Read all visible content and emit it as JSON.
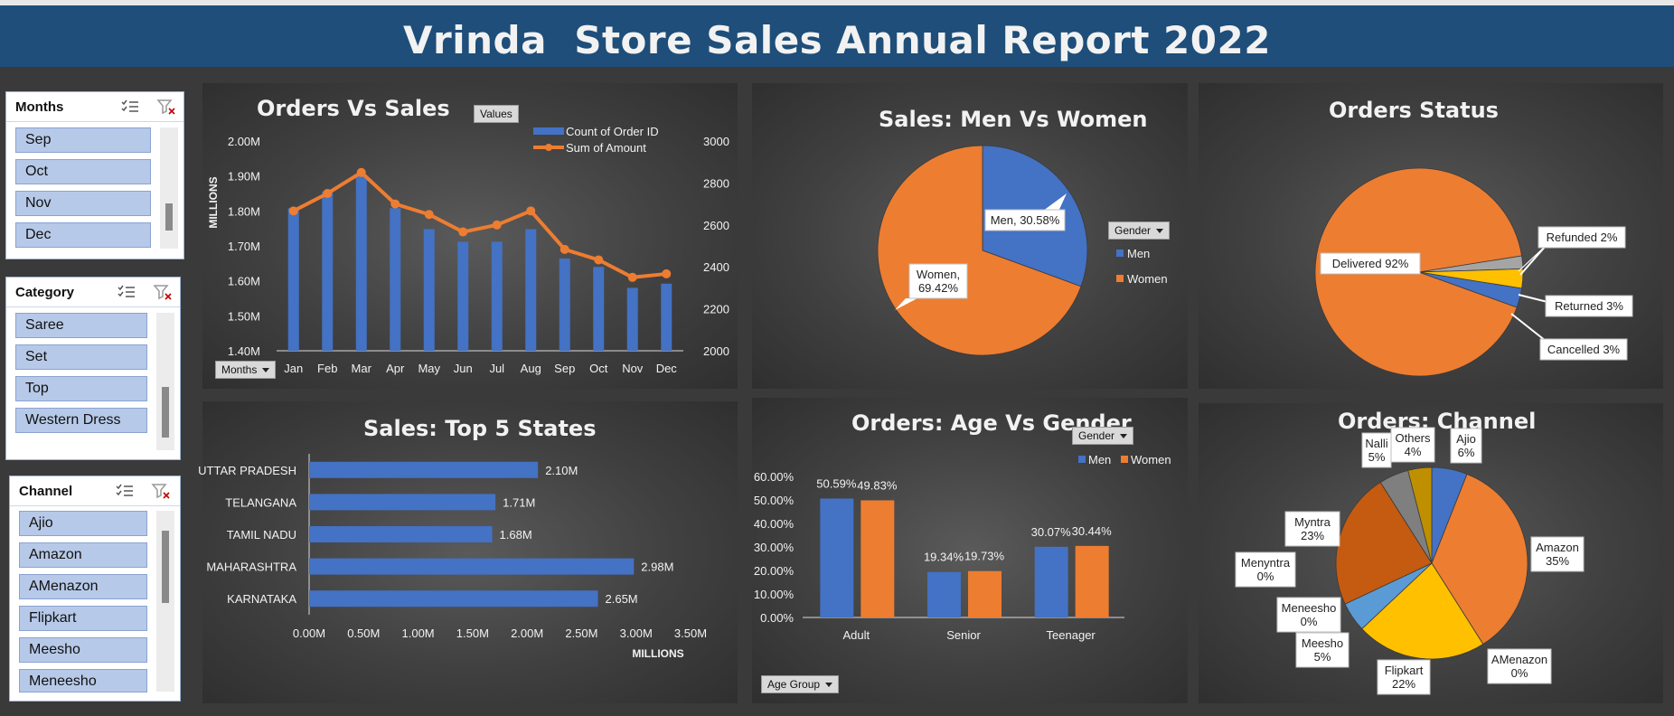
{
  "title": "Vrinda  Store Sales Annual Report 2022",
  "slicers": [
    {
      "title": "Months",
      "items": [
        "Sep",
        "Oct",
        "Nov",
        "Dec"
      ]
    },
    {
      "title": "Category",
      "items": [
        "Saree",
        "Set",
        "Top",
        "Western Dress"
      ]
    },
    {
      "title": "Channel",
      "items": [
        "Ajio",
        "Amazon",
        "AMenazon",
        "Flipkart",
        "Meesho",
        "Meneesho"
      ]
    }
  ],
  "colors": {
    "blue": "#4472c4",
    "orange": "#ed7d31",
    "gray": "#a5a5a5",
    "gold": "#ffc000",
    "lightblue": "#5b9bd5",
    "darkorange": "#c55a11",
    "darkgray": "#7f7f7f",
    "olive": "#bf8f00"
  },
  "chart_data": [
    {
      "id": "orders-vs-sales",
      "type": "bar",
      "title": "Orders Vs Sales",
      "button_values": "Values",
      "button_months": "Months",
      "categories": [
        "Jan",
        "Feb",
        "Mar",
        "Apr",
        "May",
        "Jun",
        "Jul",
        "Aug",
        "Sep",
        "Oct",
        "Nov",
        "Dec"
      ],
      "series": [
        {
          "name": "Count of Order ID",
          "type": "bar",
          "axis": "right",
          "values": [
            2680,
            2760,
            2840,
            2680,
            2580,
            2520,
            2520,
            2580,
            2440,
            2400,
            2300,
            2320
          ]
        },
        {
          "name": "Sum of Amount",
          "type": "line",
          "axis": "left",
          "values": [
            1.8,
            1.85,
            1.91,
            1.82,
            1.79,
            1.74,
            1.76,
            1.8,
            1.69,
            1.66,
            1.61,
            1.62
          ]
        }
      ],
      "ylabel": "MILLIONS",
      "ylim": [
        1.4,
        2.0
      ],
      "y_ticks": [
        "1.40M",
        "1.50M",
        "1.60M",
        "1.70M",
        "1.80M",
        "1.90M",
        "2.00M"
      ],
      "y2lim": [
        2000,
        3000
      ],
      "y2_ticks": [
        "2000",
        "2200",
        "2400",
        "2600",
        "2800",
        "3000"
      ],
      "legend": "top-right"
    },
    {
      "id": "sales-men-women",
      "type": "pie",
      "title": "Sales: Men Vs Women",
      "filter": "Gender",
      "labels": [
        "Men",
        "Women"
      ],
      "values": [
        30.58,
        69.42
      ],
      "data_labels": [
        "Men, 30.58%",
        "Women,",
        "69.42%"
      ],
      "legend": "right"
    },
    {
      "id": "orders-status",
      "type": "pie",
      "title": "Orders Status",
      "labels": [
        "Delivered",
        "Refunded",
        "Returned",
        "Cancelled"
      ],
      "values": [
        92,
        2,
        3,
        3
      ],
      "data_labels": [
        "Delivered 92%",
        "Refunded 2%",
        "Returned 3%",
        "Cancelled 3%"
      ]
    },
    {
      "id": "sales-top-states",
      "type": "bar",
      "orientation": "horizontal",
      "title": "Sales: Top 5 States",
      "categories": [
        "UTTAR PRADESH",
        "TELANGANA",
        "TAMIL NADU",
        "MAHARASHTRA",
        "KARNATAKA"
      ],
      "values": [
        2.1,
        1.71,
        1.68,
        2.98,
        2.65
      ],
      "data_labels": [
        "2.10M",
        "1.71M",
        "1.68M",
        "2.98M",
        "2.65M"
      ],
      "xlim": [
        0,
        3.5
      ],
      "x_ticks": [
        "0.00M",
        "0.50M",
        "1.00M",
        "1.50M",
        "2.00M",
        "2.50M",
        "3.00M",
        "3.50M"
      ],
      "xlabel": "MILLIONS"
    },
    {
      "id": "orders-age-gender",
      "type": "bar",
      "title": "Orders: Age Vs Gender",
      "filter": "Gender",
      "filter_age": "Age Group",
      "categories": [
        "Adult",
        "Senior",
        "Teenager"
      ],
      "series": [
        {
          "name": "Men",
          "values": [
            50.59,
            19.34,
            30.07
          ],
          "labels": [
            "50.59%",
            "19.34%",
            "30.07%"
          ]
        },
        {
          "name": "Women",
          "values": [
            49.83,
            19.73,
            30.44
          ],
          "labels": [
            "49.83%",
            "19.73%",
            "30.44%"
          ]
        }
      ],
      "ylim": [
        0,
        60
      ],
      "y_ticks": [
        "0.00%",
        "10.00%",
        "20.00%",
        "30.00%",
        "40.00%",
        "50.00%",
        "60.00%"
      ],
      "legend": "top-right"
    },
    {
      "id": "orders-channel",
      "type": "pie",
      "title": "Orders: Channel",
      "labels": [
        "Ajio",
        "Amazon",
        "AMenazon",
        "Flipkart",
        "Meesho",
        "Meneesho",
        "Menyntra",
        "Myntra",
        "Nalli",
        "Others"
      ],
      "values": [
        6,
        35,
        0,
        22,
        5,
        0,
        0,
        23,
        5,
        4
      ],
      "data_labels": [
        [
          "Ajio",
          "6%"
        ],
        [
          "Amazon",
          "35%"
        ],
        [
          "AMenazon",
          "0%"
        ],
        [
          "Flipkart",
          "22%"
        ],
        [
          "Meesho",
          "5%"
        ],
        [
          "Meneesho",
          "0%"
        ],
        [
          "Menyntra",
          "0%"
        ],
        [
          "Myntra",
          "23%"
        ],
        [
          "Nalli",
          "5%"
        ],
        [
          "Others",
          "4%"
        ]
      ]
    }
  ]
}
